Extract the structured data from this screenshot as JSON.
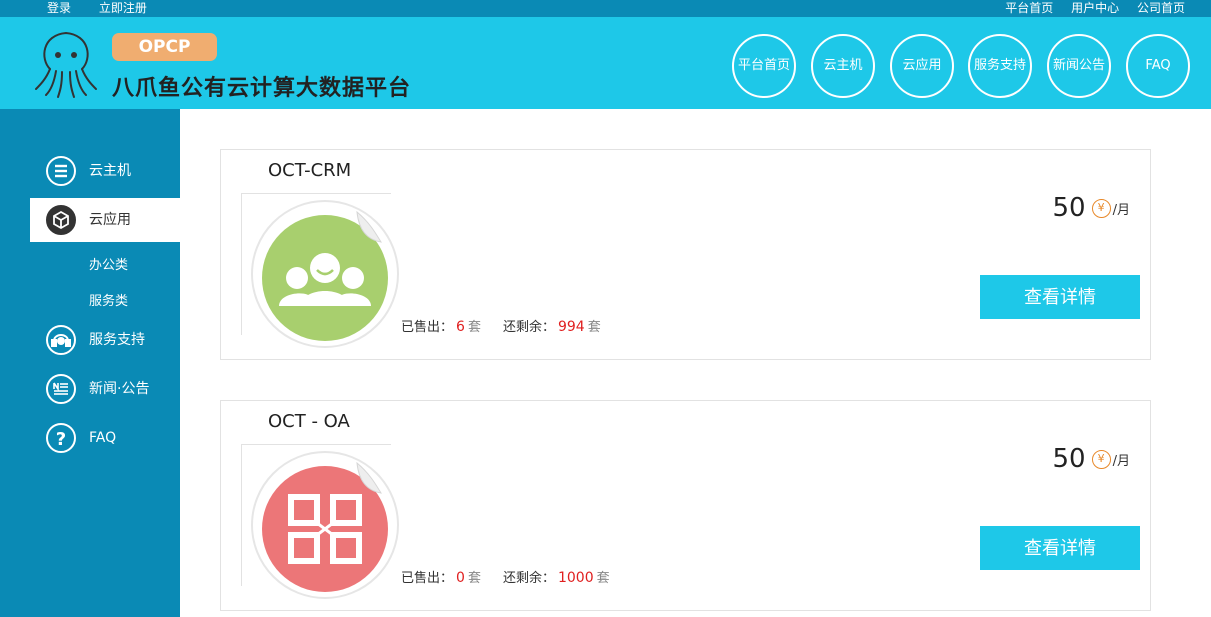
{
  "topbar": {
    "left": [
      "登录",
      "立即注册"
    ],
    "right": [
      "平台首页",
      "用户中心",
      "公司首页"
    ]
  },
  "header": {
    "badge": "OPCP",
    "title": "八爪鱼公有云计算大数据平台",
    "nav": [
      "平台首页",
      "云主机",
      "云应用",
      "服务支持",
      "新闻公告",
      "FAQ"
    ]
  },
  "sidebar": {
    "items": [
      {
        "label": "云主机",
        "icon": "server-list-icon"
      },
      {
        "label": "云应用",
        "icon": "cube-icon"
      },
      {
        "label": "服务支持",
        "icon": "headset-icon"
      },
      {
        "label": "新闻·公告",
        "icon": "newspaper-icon"
      },
      {
        "label": "FAQ",
        "icon": "question-icon"
      }
    ],
    "subitems": [
      "办公类",
      "服务类"
    ]
  },
  "products": [
    {
      "name": "OCT-CRM",
      "sold_label": "已售出：",
      "sold": "6",
      "remain_label": "还剩余：",
      "remain": "994",
      "unit": "套",
      "price": "50",
      "currency_symbol": "¥",
      "per": "/月",
      "detail_label": "查看详情",
      "icon": "users-group-icon",
      "color": "#a8cf6e"
    },
    {
      "name": "OCT - OA",
      "sold_label": "已售出：",
      "sold": "0",
      "remain_label": "还剩余：",
      "remain": "1000",
      "unit": "套",
      "price": "50",
      "currency_symbol": "¥",
      "per": "/月",
      "detail_label": "查看详情",
      "icon": "office-logo-icon",
      "color": "#ec7678"
    }
  ],
  "colors": {
    "primary": "#0a8ab5",
    "accent": "#1ec8e8",
    "badge": "#f0ad70",
    "highlight": "#e02020"
  }
}
